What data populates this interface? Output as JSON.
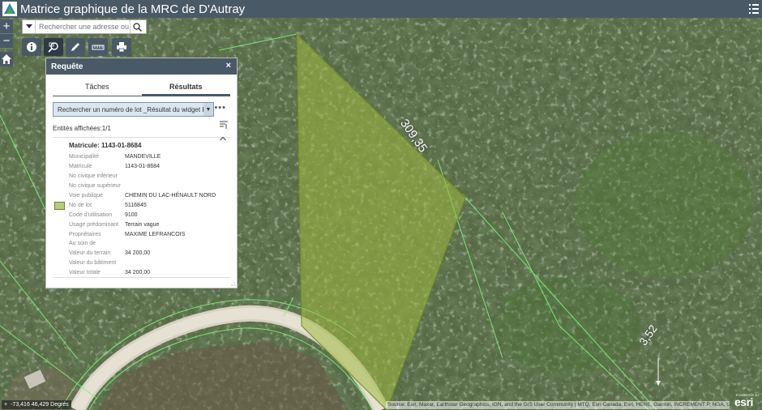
{
  "header": {
    "title": "Matrice graphique de la MRC de D'Autray",
    "menu_icon": "list-menu-icon"
  },
  "zoom": {
    "in_label": "+",
    "out_label": "−"
  },
  "search": {
    "placeholder": "Rechercher une adresse ou"
  },
  "toolbar": {
    "tools": [
      "info-icon",
      "query-icon",
      "draw-icon",
      "measure-icon",
      "print-icon"
    ]
  },
  "panel": {
    "title": "Requête",
    "close_label": "×",
    "tabs": [
      "Tâches",
      "Résultats"
    ],
    "selected_tab": "Résultats",
    "query_select": "Rechercher un numéro de lot _Résultat du widget Requête",
    "more_label": "•••",
    "count_text": "Entités affichées:1/1",
    "result_title": "Matricule: 1143-01-8684",
    "attributes": [
      {
        "key": "Municipalité",
        "value": "MANDEVILLE"
      },
      {
        "key": "Matricule",
        "value": "1143-01-8684"
      },
      {
        "key": "No civique inférieur",
        "value": ""
      },
      {
        "key": "No civique supérieur",
        "value": ""
      },
      {
        "key": "Voie publique",
        "value": "CHEMIN DU LAC-HÉNAULT NORD"
      },
      {
        "key": "No de lot",
        "value": "5116845"
      },
      {
        "key": "Code d'utilisation",
        "value": "9100"
      },
      {
        "key": "Usage prédominant",
        "value": "Terrain vague"
      },
      {
        "key": "Propriétaires",
        "value": "MAXIME LEFRANCOIS"
      },
      {
        "key": "Au soin de",
        "value": ""
      },
      {
        "key": "Valeur du terrain",
        "value": "34 200,00"
      },
      {
        "key": "Valeur du bâtiment",
        "value": ""
      },
      {
        "key": "Valeur totale",
        "value": "34 200,00"
      }
    ]
  },
  "map": {
    "dimension_labels": [
      "309,35",
      "3,52"
    ],
    "parcel_fill": "#9fb83f",
    "line_color": "#7df27a"
  },
  "footer": {
    "coordinates": "-73,416 46,429 Degrés",
    "attribution": "Source: Esri, Maxar, Earthstar Geographics, IGN, and the GIS User Community | MTQ, Esri Canada, Esri, HERE, Garmin, INCREMENT P, NGA, USGS",
    "esri_powered": "POWERED BY",
    "esri_name": "esri"
  }
}
